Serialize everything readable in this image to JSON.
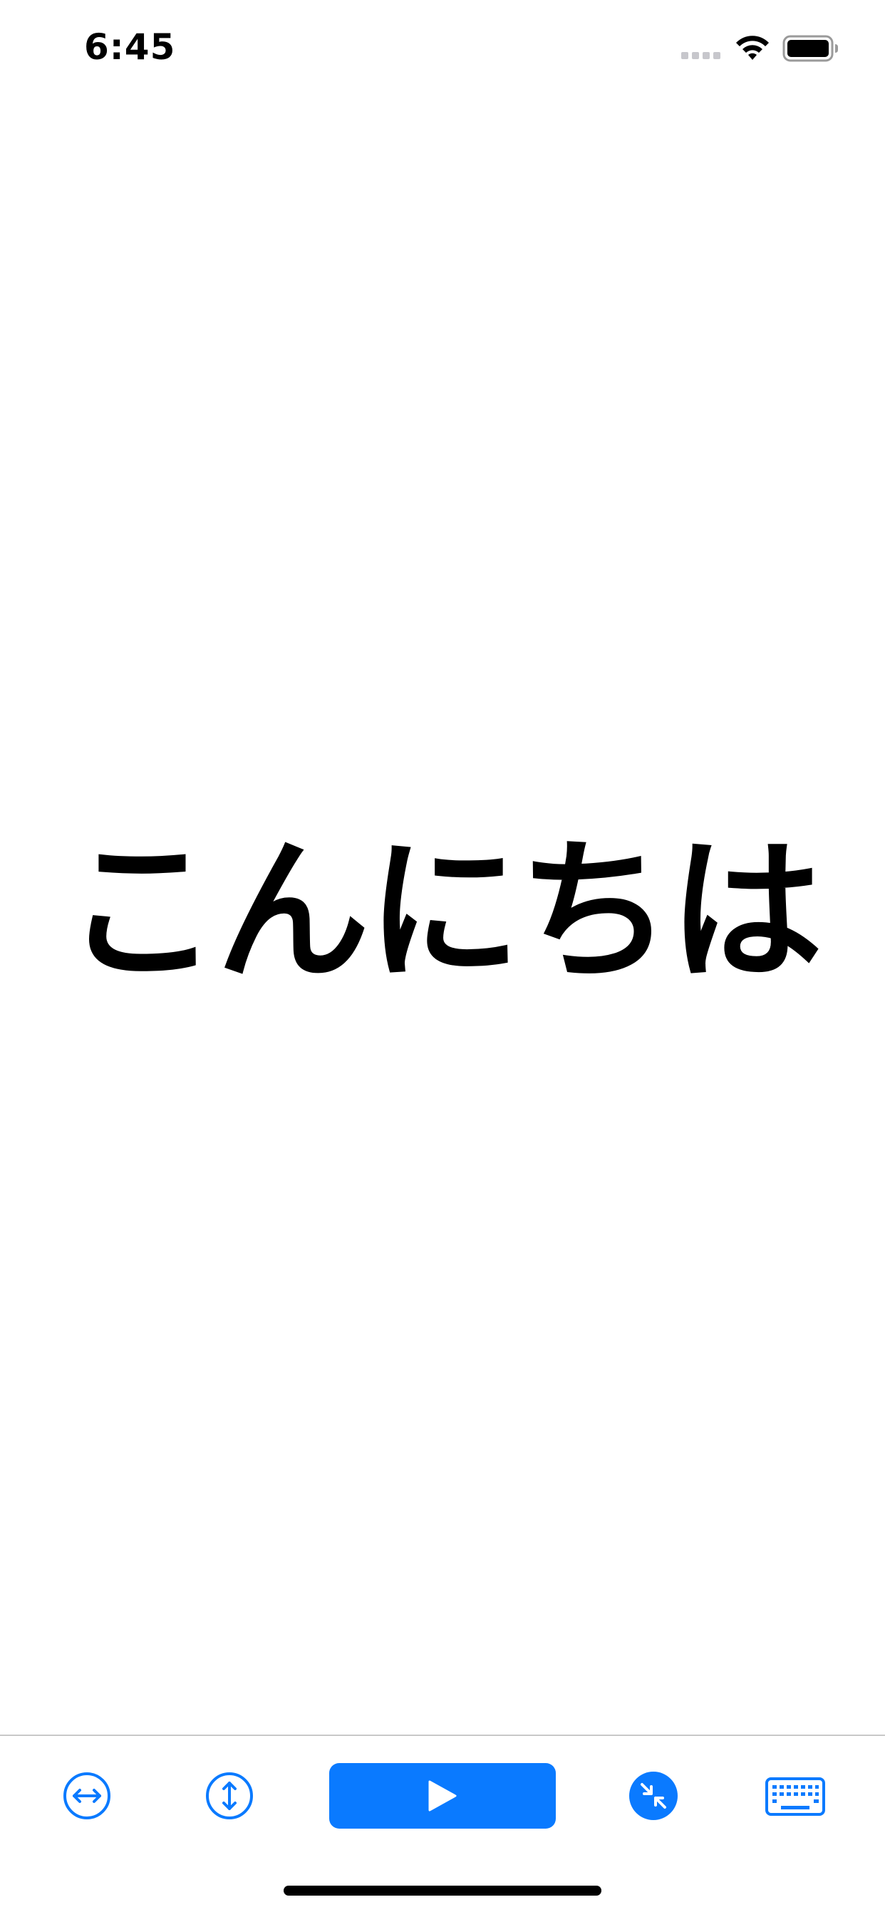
{
  "status_bar": {
    "time": "6:45",
    "icons": [
      "signal-dots-icon",
      "wifi-icon",
      "battery-icon"
    ]
  },
  "main": {
    "text": "こんにちは"
  },
  "toolbar": {
    "buttons": [
      {
        "name": "horizontal-stretch-button",
        "icon": "left-right-arrows-circle-icon"
      },
      {
        "name": "vertical-stretch-button",
        "icon": "up-down-arrows-circle-icon"
      },
      {
        "name": "play-button",
        "icon": "play-icon"
      },
      {
        "name": "collapse-button",
        "icon": "arrows-inward-circle-icon"
      },
      {
        "name": "keyboard-button",
        "icon": "keyboard-icon"
      }
    ]
  },
  "colors": {
    "accent": "#0a7aff",
    "text": "#000000",
    "background": "#ffffff",
    "divider": "#c8c8c8"
  }
}
